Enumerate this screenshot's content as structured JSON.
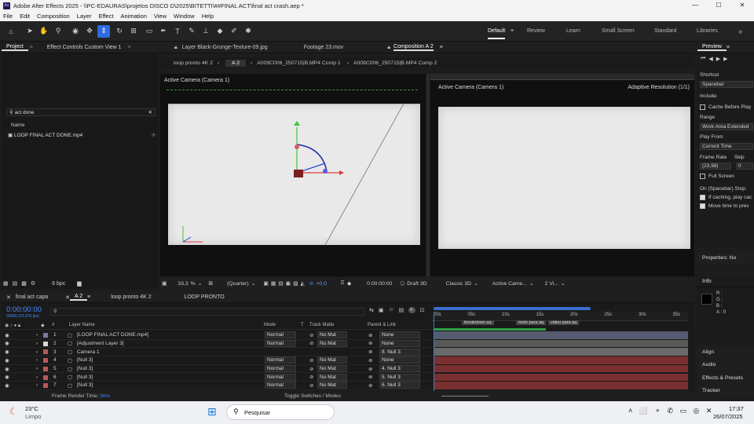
{
  "window": {
    "title": "Adobe After Effects 2025 - \\\\PC-EDAURAS\\projetos DISCO D\\2025\\BITETTI\\##FINAL ACT\\final act crash.aep *",
    "logo": "Ae",
    "controls": [
      "—",
      "☐",
      "✕"
    ]
  },
  "menu": [
    "File",
    "Edit",
    "Composition",
    "Layer",
    "Effect",
    "Animation",
    "View",
    "Window",
    "Help"
  ],
  "toolbar": {
    "tools": [
      "home-icon",
      "arrow-icon",
      "hand-icon",
      "zoom-icon",
      "orbit-icon",
      "move-icon",
      "camera-icon",
      "rotate-icon",
      "anchor-icon",
      "mask-icon",
      "pen-icon",
      "type-icon",
      "brush-icon",
      "stamp-icon",
      "eraser-icon",
      "roto-icon",
      "puppet-icon"
    ],
    "workspaces": [
      "Default",
      "Review",
      "Learn",
      "Small Screen",
      "Standard",
      "Libraries"
    ],
    "overflow": "»"
  },
  "project": {
    "tab_project": "Project",
    "tab_effect": "Effect Controls Custom View 1",
    "search_value": "act done",
    "col_name": "Name",
    "item": "LOOP FINAL ACT DONE.mp4",
    "bpc": "8 bpc"
  },
  "comp_tabs": {
    "layer": "Layer Black-Grunge-Texture-09.jpg",
    "footage": "Footage 23.mov",
    "composition": "Composition A 2"
  },
  "breadcrumbs": [
    "loop pronto 4K 2",
    "A 2",
    "A009C006_250715|B.MP4 Comp 1",
    "A009C006_250715|B.MP4 Comp 2"
  ],
  "viewer_left": {
    "label": "Active Camera (Camera 1)",
    "zoom": "33,3",
    "zoom_unit": "%",
    "quality": "(Quarter)"
  },
  "viewer_right": {
    "label": "Active Camera (Camera 1)",
    "resolution": "Adaptive Resolution (1/1)",
    "exposure": "+0,0",
    "timecode": "0:00:00:00",
    "renderer": "Draft 3D",
    "renderer2": "Classic 3D",
    "camera": "Active Came...",
    "views": "2 Vi..."
  },
  "timeline": {
    "tabs": [
      "final act capa",
      "A 2",
      "loop pronto 4K 2",
      "LOOP PRONTO"
    ],
    "timecode": "0:00:00:00",
    "frame_info": "00000 (23.976 fps)",
    "headers": {
      "num": "#",
      "name": "Layer Name",
      "mode": "Mode",
      "t": "T",
      "matte": "Track Matte",
      "parent": "Parent & Link"
    },
    "ruler": [
      "00s",
      "05s",
      "10s",
      "15s",
      "20s",
      "25s",
      "30s",
      "35s"
    ],
    "markers": [
      "breakdown aq",
      "texto para aq",
      "video para aq"
    ],
    "layers": [
      {
        "n": "1",
        "name": "[LOOP FINAL ACT DONE.mp4]",
        "mode": "Normal",
        "matte": "No Mat",
        "parent": "None",
        "color": "#7a7a9a"
      },
      {
        "n": "2",
        "name": "[Adjustment Layer 3]",
        "mode": "Normal",
        "matte": "No Mat",
        "parent": "None",
        "color": "#d8d8d8"
      },
      {
        "n": "3",
        "name": "Camera 1",
        "mode": "",
        "matte": "",
        "parent": "8. Null 3",
        "color": "#b45a5a"
      },
      {
        "n": "4",
        "name": "[Null 3]",
        "mode": "Normal",
        "matte": "No Mat",
        "parent": "None",
        "color": "#b45a5a"
      },
      {
        "n": "5",
        "name": "[Null 3]",
        "mode": "Normal",
        "matte": "No Mat",
        "parent": "4. Null 3",
        "color": "#b45a5a"
      },
      {
        "n": "6",
        "name": "[Null 3]",
        "mode": "Normal",
        "matte": "No Mat",
        "parent": "5. Null 3",
        "color": "#b45a5a"
      },
      {
        "n": "7",
        "name": "[Null 3]",
        "mode": "Normal",
        "matte": "No Mat",
        "parent": "6. Null 3",
        "color": "#b45a5a"
      }
    ],
    "footer_left": "Frame Render Time:",
    "footer_value": "0ms",
    "footer_toggle": "Toggle Switches / Modes"
  },
  "preview": {
    "title": "Preview",
    "shortcut_label": "Shortcut",
    "shortcut": "Spacebar",
    "include": "Include:",
    "cache": "Cache Before Play",
    "range_label": "Range",
    "range": "Work Area Extended",
    "playfrom_label": "Play From",
    "playfrom": "Current Time",
    "fr_label": "Frame Rate",
    "skip_label": "Skip",
    "fr": "(23,98)",
    "skip": "0",
    "fullscreen": "Full Screen",
    "stop_label": "On (Spacebar) Stop:",
    "opt1": "If caching, play cac",
    "opt2": "Move time to prev"
  },
  "right_panels": {
    "properties": "Properties: No",
    "info": "Info",
    "info_r": "R :",
    "info_g": "G :",
    "info_b": "B :",
    "info_a": "A : 0",
    "align": "Align",
    "audio": "Audio",
    "effects": "Effects & Presets",
    "tracker": "Tracker"
  },
  "taskbar": {
    "temp": "23°C",
    "weather": "Limpo",
    "search": "Pesquisar",
    "time": "17:37",
    "date": "26/07/2025"
  },
  "colors": {
    "accent": "#2d6be0",
    "green_bar": "#2ea043",
    "red_bar": "#7a3030"
  }
}
